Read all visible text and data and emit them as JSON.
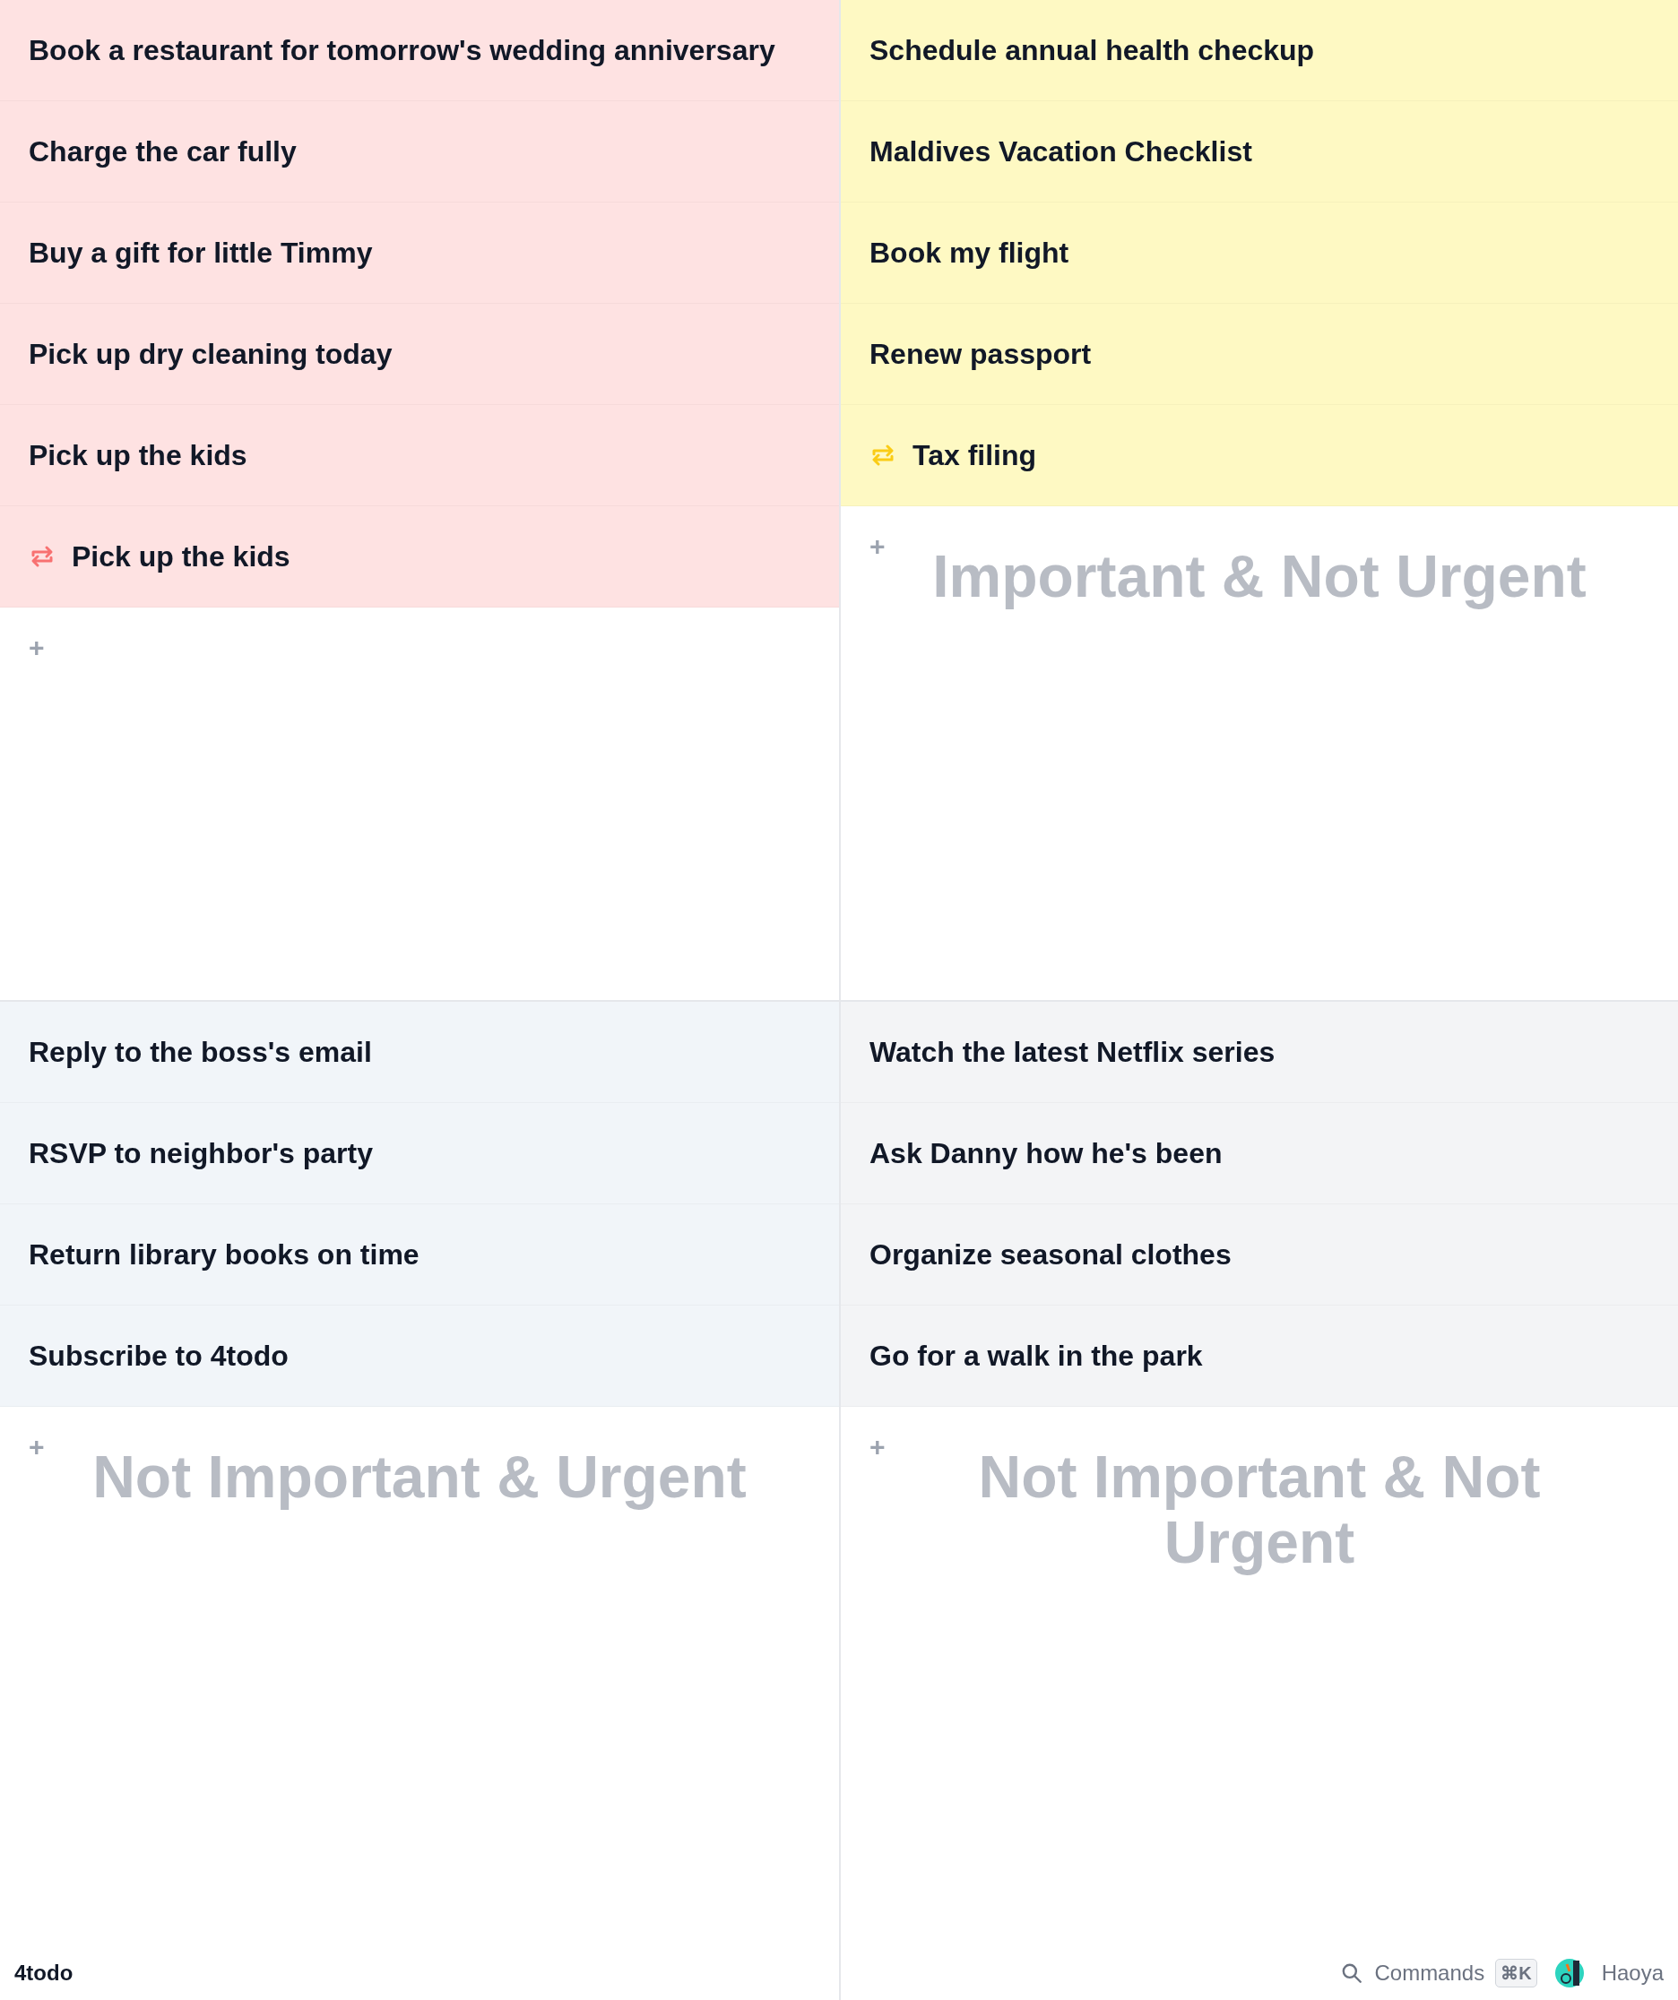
{
  "quadrants": [
    {
      "color": "#fee2e2",
      "items": [
        {
          "text": "Book a restaurant for tomorrow's wedding anniversary",
          "recurring": false
        },
        {
          "text": "Charge the car fully",
          "recurring": false
        },
        {
          "text": "Buy a gift for little Timmy",
          "recurring": false
        },
        {
          "text": "Pick up dry cleaning today",
          "recurring": false
        },
        {
          "text": "Pick up the kids",
          "recurring": false
        },
        {
          "text": "Pick up the kids",
          "recurring": true
        }
      ],
      "add_button": "+"
    },
    {
      "color": "#fef9c3",
      "title": "Important & Not Urgent",
      "items": [
        {
          "text": "Schedule annual health checkup",
          "recurring": false
        },
        {
          "text": "Maldives Vacation Checklist",
          "recurring": false
        },
        {
          "text": "Book my flight",
          "recurring": false
        },
        {
          "text": "Renew passport",
          "recurring": false
        },
        {
          "text": "Tax filing",
          "recurring": true
        }
      ],
      "add_button": "+"
    },
    {
      "color": "#f1f5f9",
      "title": "Not Important & Urgent",
      "items": [
        {
          "text": "Reply to the boss's email",
          "recurring": false
        },
        {
          "text": "RSVP to neighbor's party",
          "recurring": false
        },
        {
          "text": "Return library books on time",
          "recurring": false
        },
        {
          "text": "Subscribe to 4todo",
          "recurring": false
        }
      ],
      "add_button": "+"
    },
    {
      "color": "#f3f4f6",
      "title": "Not Important & Not Urgent",
      "items": [
        {
          "text": "Watch the latest Netflix series",
          "recurring": false
        },
        {
          "text": "Ask Danny how he's been",
          "recurring": false
        },
        {
          "text": "Organize seasonal clothes",
          "recurring": false
        },
        {
          "text": "Go for a walk in the park",
          "recurring": false
        }
      ],
      "add_button": "+"
    }
  ],
  "footer": {
    "logo": "4todo",
    "commands": "Commands",
    "shortcut": "⌘K",
    "user": "Haoya"
  }
}
